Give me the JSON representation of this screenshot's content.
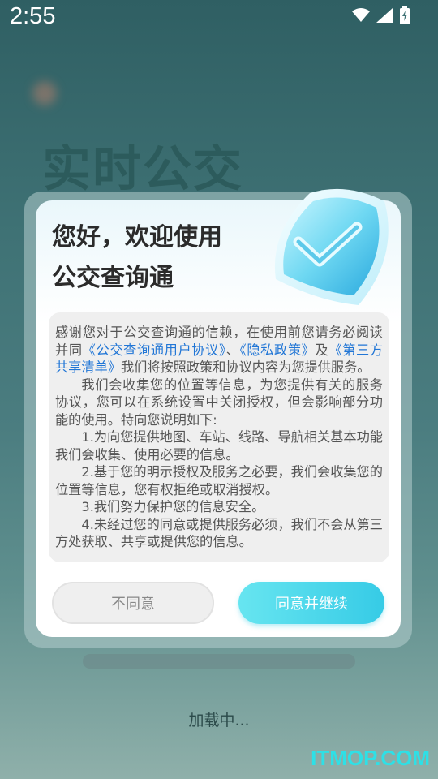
{
  "statusbar": {
    "time": "2:55"
  },
  "background": {
    "title": "实时公交",
    "loading_text": "加载中..."
  },
  "dialog": {
    "title_line1": "您好，欢迎使用",
    "title_line2": "公交查询通",
    "content": {
      "p1_a": "感谢您对于公交查询通的信赖，在使用前您请务必阅读并同",
      "link_user_agreement": "《公交查询通用户协议》",
      "sep1": "、",
      "link_privacy": "《隐私政策》",
      "sep2": "及",
      "link_third_party": "《第三方共享清单》",
      "p1_b": "我们将按照政策和协议内容为您提供服务。",
      "p2": "我们会收集您的位置等信息，为您提供有关的服务协议，您可以在系统设置中关闭授权，但会影响部分功能的使用。特向您说明如下:",
      "p3": "1.为向您提供地图、车站、线路、导航相关基本功能我们会收集、使用必要的信息。",
      "p4": "2.基于您的明示授权及服务之必要，我们会收集您的位置等信息，您有权拒绝或取消授权。",
      "p5": "3.我们努力保护您的信息安全。",
      "p6": "4.未经过您的同意或提供服务必须，我们不会从第三方处获取、共享或提供您的信息。"
    },
    "disagree_label": "不同意",
    "agree_label": "同意并继续"
  },
  "watermark": "ITMOP.COM",
  "icons": {
    "shield": "shield-check-icon",
    "wifi": "wifi-icon",
    "signal": "signal-icon",
    "battery": "battery-charging-icon"
  },
  "colors": {
    "accent": "#36cbe6",
    "link": "#2176d6"
  }
}
